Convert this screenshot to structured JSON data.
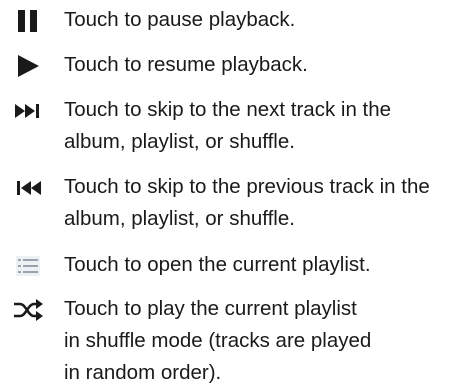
{
  "items": [
    {
      "icon": "pause-icon",
      "lines": [
        "Touch to pause playback."
      ]
    },
    {
      "icon": "play-icon",
      "lines": [
        "Touch to resume playback."
      ]
    },
    {
      "icon": "skip-next-icon",
      "lines": [
        "Touch to skip to the next track in the",
        "album, playlist, or shuffle."
      ]
    },
    {
      "icon": "skip-previous-icon",
      "lines": [
        "Touch to skip to the previous track in the",
        "album, playlist, or shuffle."
      ]
    },
    {
      "icon": "playlist-icon",
      "lines": [
        "Touch to open the current playlist."
      ]
    },
    {
      "icon": "shuffle-icon",
      "lines": [
        "Touch to play the current playlist",
        "in shuffle mode (tracks are played",
        "in random order)."
      ]
    }
  ],
  "colors": {
    "icon_dark": "#1a1a1a",
    "playlist_icon": "#9aa3ad",
    "text": "#1a1a1a"
  }
}
